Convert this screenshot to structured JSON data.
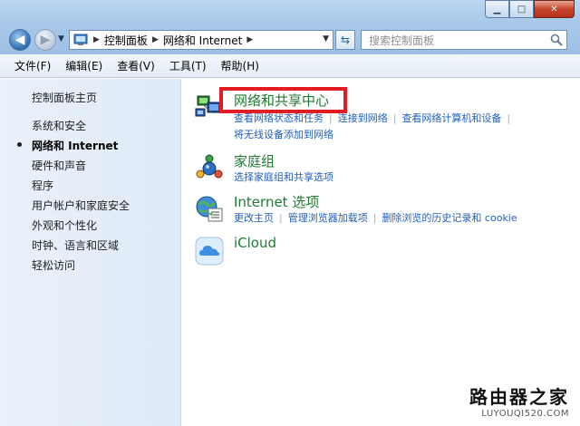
{
  "address": {
    "crumbs": [
      "控制面板",
      "网络和 Internet"
    ]
  },
  "search": {
    "placeholder": "搜索控制面板"
  },
  "window_buttons": {
    "minimize": "▁",
    "maximize": "□",
    "close": "✕"
  },
  "menu": [
    "文件(F)",
    "编辑(E)",
    "查看(V)",
    "工具(T)",
    "帮助(H)"
  ],
  "sidebar": {
    "items": [
      {
        "label": "控制面板主页",
        "current": false
      },
      {
        "label": "系统和安全",
        "current": false
      },
      {
        "label": "网络和 Internet",
        "current": true
      },
      {
        "label": "硬件和声音",
        "current": false
      },
      {
        "label": "程序",
        "current": false
      },
      {
        "label": "用户帐户和家庭安全",
        "current": false
      },
      {
        "label": "外观和个性化",
        "current": false
      },
      {
        "label": "时钟、语言和区域",
        "current": false
      },
      {
        "label": "轻松访问",
        "current": false
      }
    ]
  },
  "categories": [
    {
      "title": "网络和共享中心",
      "icon": "network-center-icon",
      "links_line1": [
        "查看网络状态和任务",
        "连接到网络",
        "查看网络计算机和设备"
      ],
      "links_line2": [
        "将无线设备添加到网络"
      ]
    },
    {
      "title": "家庭组",
      "icon": "homegroup-icon",
      "links_line1": [
        "选择家庭组和共享选项"
      ]
    },
    {
      "title": "Internet 选项",
      "icon": "internet-options-icon",
      "links_line1": [
        "更改主页",
        "管理浏览器加载项",
        "删除浏览的历史记录和 cookie"
      ]
    },
    {
      "title": "iCloud",
      "icon": "icloud-icon"
    }
  ],
  "watermark": {
    "text": "路由器之家",
    "url": "LUYOUQI520.COM"
  },
  "colors": {
    "highlight": "#e31b23",
    "category_title": "#1e7b2f",
    "link": "#1f5fbf"
  }
}
